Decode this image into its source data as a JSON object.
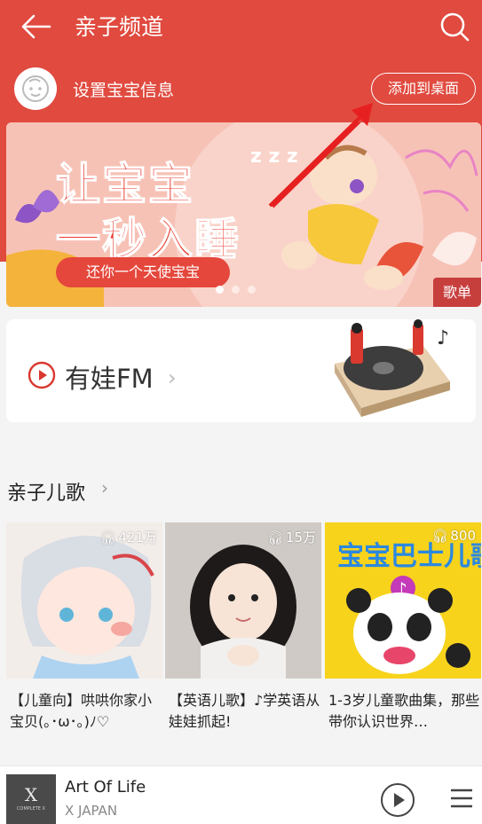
{
  "header": {
    "title": "亲子频道",
    "bg_color": "#e04a3f"
  },
  "baby": {
    "label": "设置宝宝信息",
    "add_to_desktop": "添加到桌面"
  },
  "banner": {
    "line1": "让宝宝",
    "line2": "一秒入睡",
    "pill": "还你一个天使宝宝",
    "tag": "歌单",
    "page_count": 3,
    "active_page": 1
  },
  "fm": {
    "label": "有娃FM"
  },
  "section": {
    "title": "亲子儿歌"
  },
  "playlists": [
    {
      "plays": "421万",
      "title": "【儿童向】哄哄你家小宝贝(｡･ω･｡)ﾉ♡"
    },
    {
      "plays": "15万",
      "title": "【英语儿歌】♪学英语从娃娃抓起!"
    },
    {
      "plays": "800",
      "title": "1-3岁儿童歌曲集，那些带你认识世界…"
    }
  ],
  "player": {
    "song": "Art Of Life",
    "artist": "X JAPAN",
    "cover_text": "COMPLETE X"
  }
}
